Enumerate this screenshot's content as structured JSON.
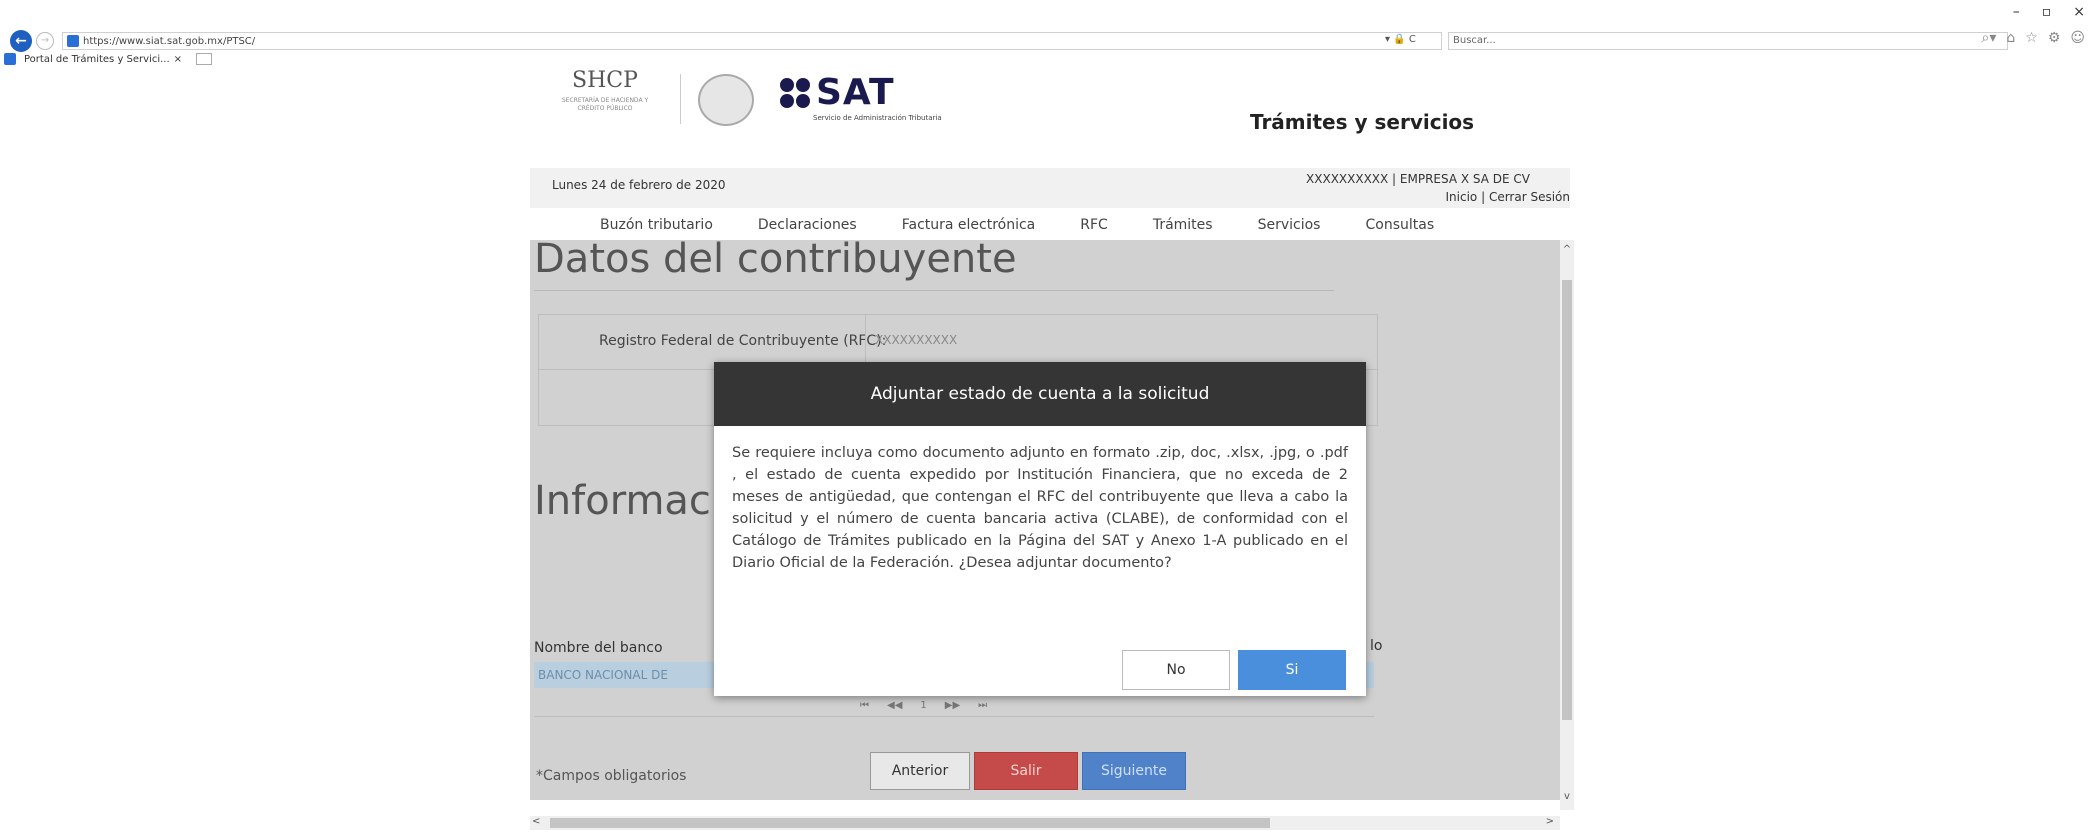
{
  "browser": {
    "url": "https://www.siat.sat.gob.mx/PTSC/",
    "search_placeholder": "Buscar...",
    "tab_title": "Portal de Trámites y Servici...",
    "tab_close": "×",
    "back_icon": "←",
    "forward_icon": "→",
    "addr_tools": "▾ 🔒 C",
    "minimize": "–",
    "maximize": "▫",
    "close": "×",
    "search_icon": "⌕▾",
    "home_icon": "⌂",
    "star_icon": "☆",
    "settings_icon": "⚙",
    "smiley_icon": "☺"
  },
  "header": {
    "shcp_title": "SHCP",
    "shcp_sub": "SECRETARÍA DE HACIENDA Y CRÉDITO PÚBLICO",
    "sat_word": "SAT",
    "sat_sub": "Servicio de Administración Tributaria",
    "section_title": "Trámites y servicios"
  },
  "info_bar": {
    "date": "Lunes 24 de febrero de 2020",
    "user": "XXXXXXXXXX | EMPRESA X SA DE CV",
    "links": "Inicio | Cerrar Sesión"
  },
  "nav": {
    "items": [
      "Buzón tributario",
      "Declaraciones",
      "Factura electrónica",
      "RFC",
      "Trámites",
      "Servicios",
      "Consultas"
    ]
  },
  "content": {
    "title": "Datos del contribuyente",
    "rfc_label": "Registro Federal de Contribuyente (RFC):",
    "rfc_value": "XXXXXXXXXX",
    "section2_title": "Informac",
    "bank_header": "Nombre del banco",
    "bank_header_2": "lo",
    "bank_row": "BANCO NACIONAL DE",
    "pager": [
      "⏮",
      "◀◀",
      "1",
      "▶▶",
      "⏭"
    ],
    "required_note": "*Campos obligatorios",
    "btn_anterior": "Anterior",
    "btn_salir": "Salir",
    "btn_siguiente": "Siguiente",
    "scroll_up": "^",
    "scroll_down": "v",
    "scroll_left": "<",
    "scroll_right": ">"
  },
  "modal": {
    "title": "Adjuntar estado de cuenta a la solicitud",
    "body": "Se requiere incluya como documento adjunto en formato .zip, doc, .xlsx, .jpg, o .pdf , el estado de cuenta expedido por Institución Financiera, que no exceda de 2 meses de antigüedad, que contengan el RFC del contribuyente que lleva a cabo la solicitud y el número de cuenta bancaria activa (CLABE), de conformidad con el Catálogo de Trámites publicado en la Página del SAT y Anexo 1-A publicado en el Diario Oficial de la Federación. ¿Desea adjuntar documento?",
    "btn_no": "No",
    "btn_si": "Si"
  }
}
